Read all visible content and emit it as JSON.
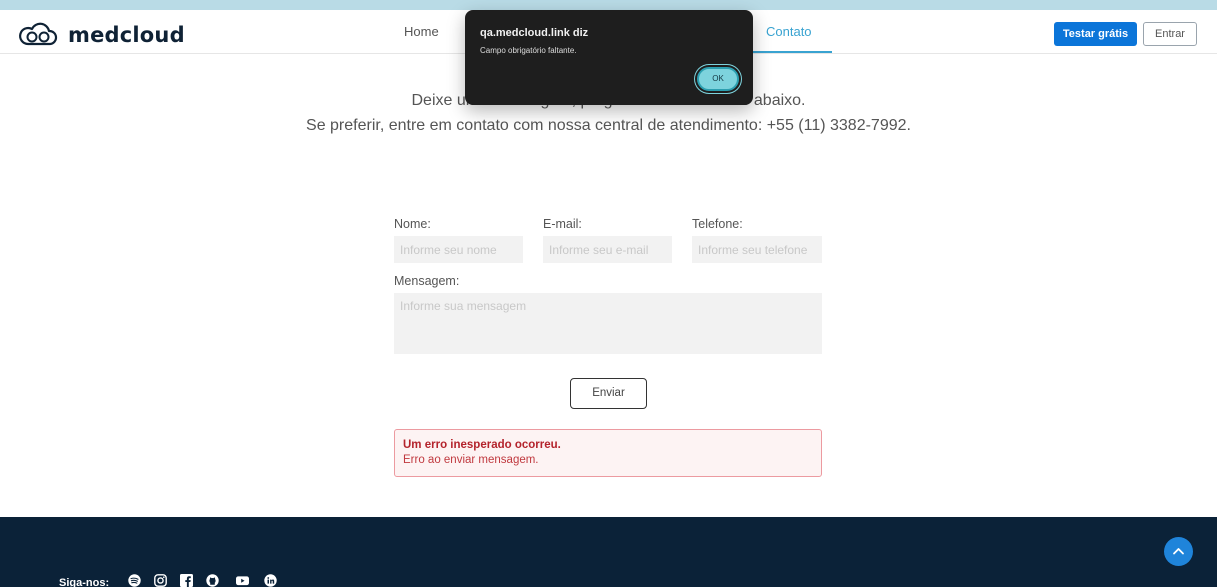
{
  "header": {
    "brand": "medcloud",
    "nav": {
      "home": "Home",
      "contact": "Contato"
    },
    "trial_button": "Testar grátis",
    "login_button": "Entrar"
  },
  "intro": {
    "line1": "Deixe uma mensagem, pergunta ou comentário abaixo.",
    "line2": "Se preferir, entre em contato com nossa central de atendimento: +55 (11) 3382-7992."
  },
  "form": {
    "name": {
      "label": "Nome:",
      "placeholder": "Informe seu nome",
      "value": ""
    },
    "email": {
      "label": "E-mail:",
      "placeholder": "Informe seu e-mail",
      "value": ""
    },
    "phone": {
      "label": "Telefone:",
      "placeholder": "Informe seu telefone",
      "value": ""
    },
    "message": {
      "label": "Mensagem:",
      "placeholder": "Informe sua mensagem",
      "value": ""
    },
    "submit": "Enviar"
  },
  "error": {
    "title": "Um erro inesperado ocorreu.",
    "text": "Erro ao enviar mensagem."
  },
  "footer": {
    "follow_label": "Siga-nos:",
    "social_icons": [
      "spotify-icon",
      "instagram-icon",
      "facebook-icon",
      "github-icon",
      "youtube-icon",
      "linkedin-icon"
    ]
  },
  "dialog": {
    "title": "qa.medcloud.link diz",
    "message": "Campo obrigatório faltante.",
    "ok": "OK"
  },
  "colors": {
    "brand_dark": "#0f2235",
    "accent": "#39a3d1",
    "primary_button": "#0b75d9",
    "footer_bg": "#0b2238",
    "error_border": "#ec9aa0",
    "error_text": "#b4232c"
  }
}
